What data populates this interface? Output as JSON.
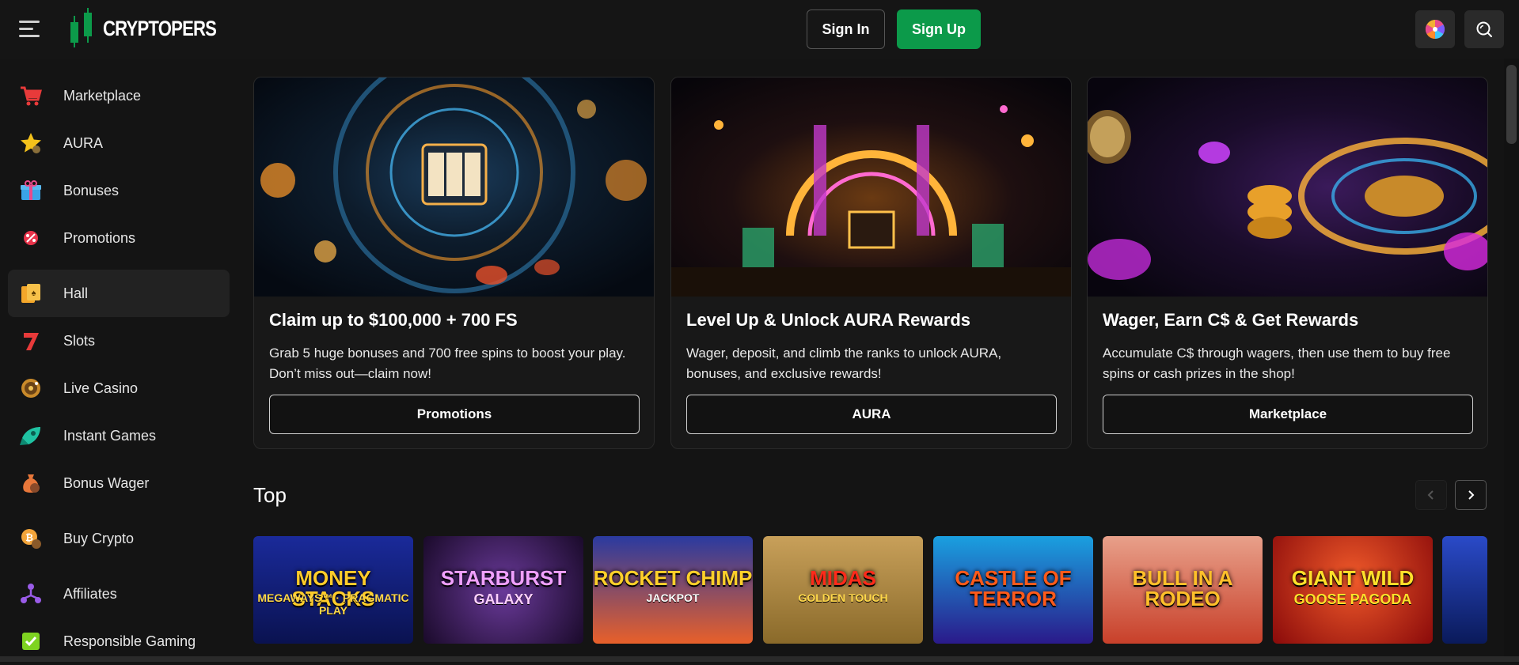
{
  "header": {
    "logo_text": "CRYPTOPERS",
    "signin_label": "Sign In",
    "signup_label": "Sign Up",
    "brand_color": "#0c9a4a"
  },
  "sidebar": {
    "items": [
      {
        "label": "Marketplace",
        "icon": "cart-icon"
      },
      {
        "label": "AURA",
        "icon": "star-icon"
      },
      {
        "label": "Bonuses",
        "icon": "gift-icon"
      },
      {
        "label": "Promotions",
        "icon": "promo-icon"
      },
      {
        "label": "Hall",
        "icon": "hall-icon"
      },
      {
        "label": "Slots",
        "icon": "slot-seven-icon"
      },
      {
        "label": "Live Casino",
        "icon": "roulette-icon"
      },
      {
        "label": "Instant Games",
        "icon": "rocket-icon"
      },
      {
        "label": "Bonus Wager",
        "icon": "money-bag-icon"
      },
      {
        "label": "Buy Crypto",
        "icon": "coin-icon"
      },
      {
        "label": "Affiliates",
        "icon": "network-icon"
      },
      {
        "label": "Responsible Gaming",
        "icon": "shield-check-icon"
      }
    ]
  },
  "promos": [
    {
      "title": "Claim up to $100,000 + 700 FS",
      "desc": "Grab 5 huge bonuses and 700 free spins to boost your play. Don’t miss out—claim now!",
      "button": "Promotions"
    },
    {
      "title": "Level Up & Unlock AURA Rewards",
      "desc": "Wager, deposit, and climb the ranks to unlock AURA, bonuses, and exclusive rewards!",
      "button": "AURA"
    },
    {
      "title": "Wager, Earn C$ & Get Rewards",
      "desc": "Accumulate C$ through wagers, then use them to buy free spins or cash prizes in the shop!",
      "button": "Marketplace"
    }
  ],
  "top": {
    "title": "Top",
    "games": [
      {
        "title": "MONEY STACKS",
        "sub": "MEGAWAYS™ · PRAGMATIC PLAY"
      },
      {
        "title": "STARBURST",
        "sub": "GALAXY"
      },
      {
        "title": "ROCKET CHIMP",
        "sub": "JACKPOT"
      },
      {
        "title": "MIDAS",
        "sub": "GOLDEN TOUCH"
      },
      {
        "title": "CASTLE OF TERROR",
        "sub": ""
      },
      {
        "title": "BULL IN A RODEO",
        "sub": ""
      },
      {
        "title": "GIANT WILD",
        "sub": "GOOSE PAGODA"
      },
      {
        "title": "",
        "sub": ""
      }
    ]
  }
}
